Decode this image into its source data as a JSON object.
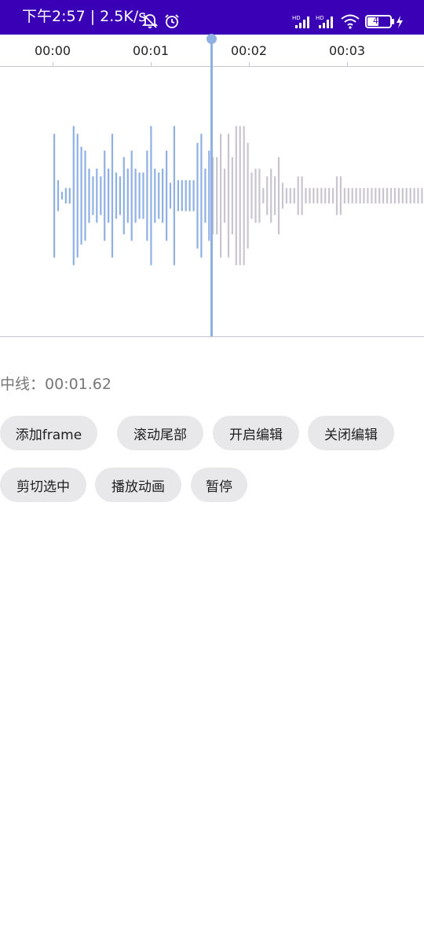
{
  "status_bar": {
    "text": "下午2:57 | 2.5K/s",
    "battery_level": "48"
  },
  "timeline": {
    "tick_labels": [
      "00:00",
      "00:01",
      "00:02",
      "00:03"
    ],
    "playhead_fraction": 0.405
  },
  "waveform": {
    "played_color": "#8fb0e4",
    "unplayed_color": "#c9c4cf",
    "bar_levels": [
      0.48,
      0.12,
      0.03,
      0.06,
      0.06,
      0.54,
      0.48,
      0.38,
      0.35,
      0.21,
      0.15,
      0.21,
      0.15,
      0.35,
      0.21,
      0.48,
      0.18,
      0.15,
      0.3,
      0.21,
      0.35,
      0.21,
      0.18,
      0.18,
      0.35,
      0.54,
      0.21,
      0.18,
      0.21,
      0.35,
      0.1,
      0.54,
      0.12,
      0.12,
      0.12,
      0.12,
      0.12,
      0.41,
      0.48,
      0.21,
      0.35,
      0.3,
      0.3,
      0.48,
      0.21,
      0.48,
      0.3,
      0.54,
      0.54,
      0.54,
      0.41,
      0.18,
      0.21,
      0.21,
      0.06,
      0.15,
      0.21,
      0.15,
      0.3,
      0.1,
      0.06,
      0.06,
      0.06,
      0.15,
      0.15,
      0.06,
      0.06,
      0.06,
      0.06,
      0.06,
      0.06,
      0.06,
      0.06,
      0.15,
      0.15,
      0.06,
      0.06,
      0.06,
      0.06,
      0.06,
      0.06,
      0.06,
      0.06,
      0.06,
      0.06,
      0.06,
      0.06,
      0.06,
      0.06,
      0.06,
      0.06,
      0.06,
      0.06,
      0.06,
      0.06,
      0.06
    ]
  },
  "midline": {
    "label": "中线：",
    "value": "00:01.62"
  },
  "buttons": {
    "add_frame": "添加frame",
    "scroll_end": "滚动尾部",
    "enable_edit": "开启编辑",
    "disable_edit": "关闭编辑",
    "cut_selected": "剪切选中",
    "play_animation": "播放动画",
    "pause": "暂停"
  }
}
